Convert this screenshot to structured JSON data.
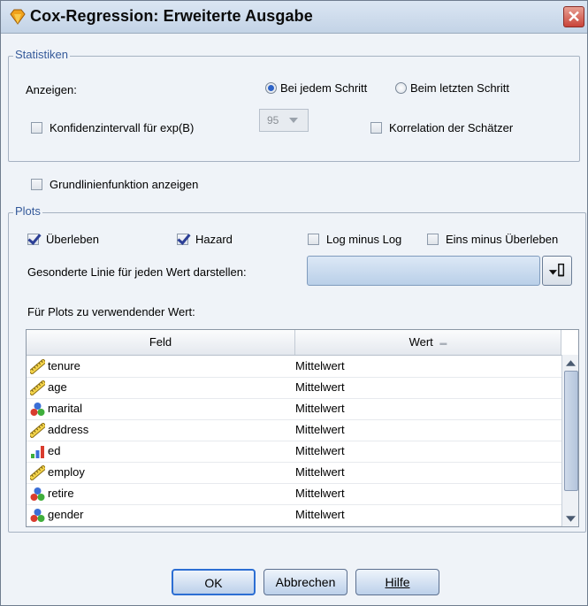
{
  "window": {
    "title": "Cox-Regression: Erweiterte Ausgabe",
    "close_glyph": "✕"
  },
  "statistiken": {
    "legend": "Statistiken",
    "anzeigen_label": "Anzeigen:",
    "radio_each": "Bei jedem Schritt",
    "radio_last": "Beim letzten Schritt",
    "radio_selected": "each",
    "konfidenz_label": "Konfidenzintervall für exp(B)",
    "konfidenz_value": "95",
    "korrelation_label": "Korrelation der Schätzer"
  },
  "grundlinie_label": "Grundlinienfunktion anzeigen",
  "plots": {
    "legend": "Plots",
    "ueberleben": {
      "label": "Überleben",
      "checked": true
    },
    "hazard": {
      "label": "Hazard",
      "checked": true
    },
    "logminuslog": {
      "label": "Log minus Log",
      "checked": false
    },
    "einsminus": {
      "label": "Eins minus Überleben",
      "checked": false
    },
    "separate_line_label": "Gesonderte Linie für jeden Wert darstellen:",
    "separate_line_value": "",
    "values_label": "Für Plots zu verwendender Wert:"
  },
  "table": {
    "columns": [
      "Feld",
      "Wert"
    ],
    "sort_indicator": "▬",
    "rows": [
      {
        "icon": "ruler-icon",
        "feld": "tenure",
        "wert": "Mittelwert"
      },
      {
        "icon": "ruler-icon",
        "feld": "age",
        "wert": "Mittelwert"
      },
      {
        "icon": "nominal-icon",
        "feld": "marital",
        "wert": "Mittelwert"
      },
      {
        "icon": "ruler-icon",
        "feld": "address",
        "wert": "Mittelwert"
      },
      {
        "icon": "ordinal-icon",
        "feld": "ed",
        "wert": "Mittelwert"
      },
      {
        "icon": "ruler-icon",
        "feld": "employ",
        "wert": "Mittelwert"
      },
      {
        "icon": "nominal-icon",
        "feld": "retire",
        "wert": "Mittelwert"
      },
      {
        "icon": "nominal-icon",
        "feld": "gender",
        "wert": "Mittelwert"
      }
    ]
  },
  "buttons": {
    "ok": "OK",
    "abbrechen": "Abbrechen",
    "hilfe": "Hilfe"
  },
  "colors": {
    "accent": "#2d63c8",
    "checkmark": "#2c3f96",
    "legend_text": "#355a9a"
  }
}
